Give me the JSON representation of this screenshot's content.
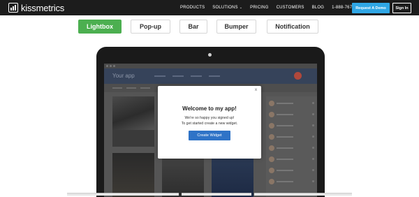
{
  "nav": {
    "logo_text": "kissmetrics",
    "links": [
      "PRODUCTS",
      "SOLUTIONS",
      "PRICING",
      "CUSTOMERS",
      "BLOG",
      "1-888-767-5477"
    ],
    "solutions_chevron": "⌄",
    "demo_button": "Request A Demo",
    "signin_button": "Sign In",
    "accent_color": "#2fa6e5"
  },
  "tabs": [
    {
      "label": "Lightbox",
      "active": true
    },
    {
      "label": "Pop-up",
      "active": false
    },
    {
      "label": "Bar",
      "active": false
    },
    {
      "label": "Bumper",
      "active": false
    },
    {
      "label": "Notification",
      "active": false
    }
  ],
  "preview": {
    "app_title": "Your app",
    "modal": {
      "close": "x",
      "title": "Welcome to my app!",
      "line1": "We're so happy you signed up!",
      "line2": "To get started create a new widget.",
      "button": "Create Widget",
      "button_color": "#2f73c7"
    }
  },
  "colors": {
    "active_tab": "#4caf50",
    "nav_bg": "#1c1c1c"
  }
}
